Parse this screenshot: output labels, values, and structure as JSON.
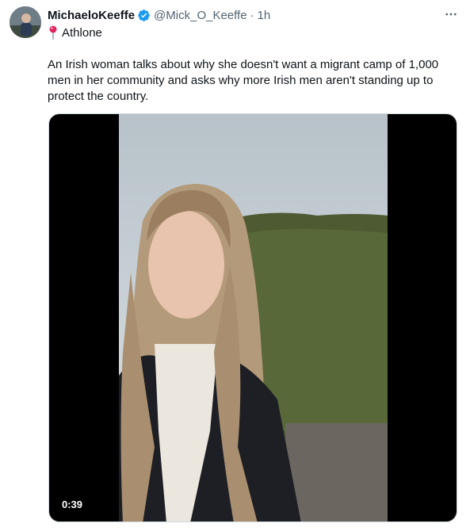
{
  "tweet": {
    "display_name": "MichaeloKeeffe",
    "handle": "@Mick_O_Keeffe",
    "separator": "·",
    "time": "1h",
    "location": "Athlone",
    "text": "An Irish woman talks about why she doesn't want a migrant camp of 1,000 men in her community and asks why more Irish men aren't standing up to protect the country."
  },
  "video": {
    "duration": "0:39"
  },
  "colors": {
    "verified": "#1d9bf0",
    "secondary_text": "#536471",
    "pin": "#e0245e"
  },
  "icons": [
    "verified-badge-icon",
    "more-options-icon",
    "location-pin-icon"
  ]
}
